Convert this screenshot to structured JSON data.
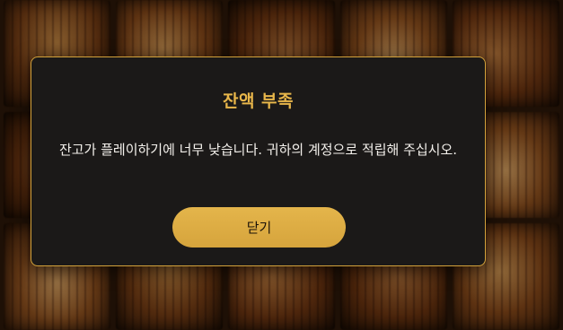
{
  "background": {
    "description_icon": "slot-reel-tiles"
  },
  "dialog": {
    "title": "잔액 부족",
    "message": "잔고가 플레이하기에 너무 낮습니다. 귀하의 계정으로 적립해 주십시오.",
    "close_label": "닫기"
  },
  "colors": {
    "accent": "#d6a43c",
    "title": "#e8b64a",
    "dialog_bg": "#1b1918",
    "dialog_border": "#d3a23b"
  }
}
